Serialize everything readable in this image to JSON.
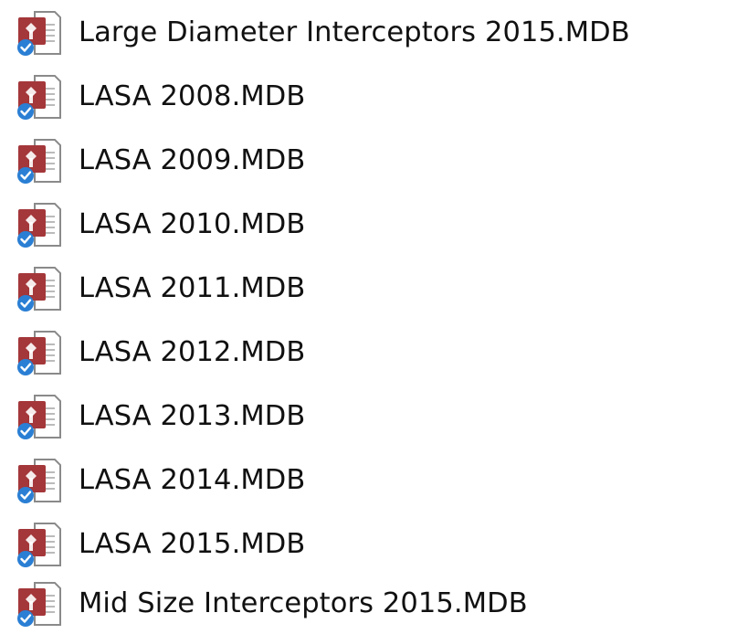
{
  "files": [
    {
      "name": "Large Diameter Interceptors 2015.MDB",
      "icon": "access-database-icon",
      "status": "synced-check"
    },
    {
      "name": "LASA 2008.MDB",
      "icon": "access-database-icon",
      "status": "synced-check"
    },
    {
      "name": "LASA 2009.MDB",
      "icon": "access-database-icon",
      "status": "synced-check"
    },
    {
      "name": "LASA 2010.MDB",
      "icon": "access-database-icon",
      "status": "synced-check"
    },
    {
      "name": "LASA 2011.MDB",
      "icon": "access-database-icon",
      "status": "synced-check"
    },
    {
      "name": "LASA 2012.MDB",
      "icon": "access-database-icon",
      "status": "synced-check"
    },
    {
      "name": "LASA 2013.MDB",
      "icon": "access-database-icon",
      "status": "synced-check"
    },
    {
      "name": "LASA 2014.MDB",
      "icon": "access-database-icon",
      "status": "synced-check"
    },
    {
      "name": "LASA 2015.MDB",
      "icon": "access-database-icon",
      "status": "synced-check"
    },
    {
      "name": "Mid Size Interceptors 2015.MDB",
      "icon": "access-database-icon",
      "status": "synced-check"
    }
  ],
  "colors": {
    "access_red": "#a4373a",
    "sync_blue": "#2a7fd4",
    "text": "#111111"
  }
}
